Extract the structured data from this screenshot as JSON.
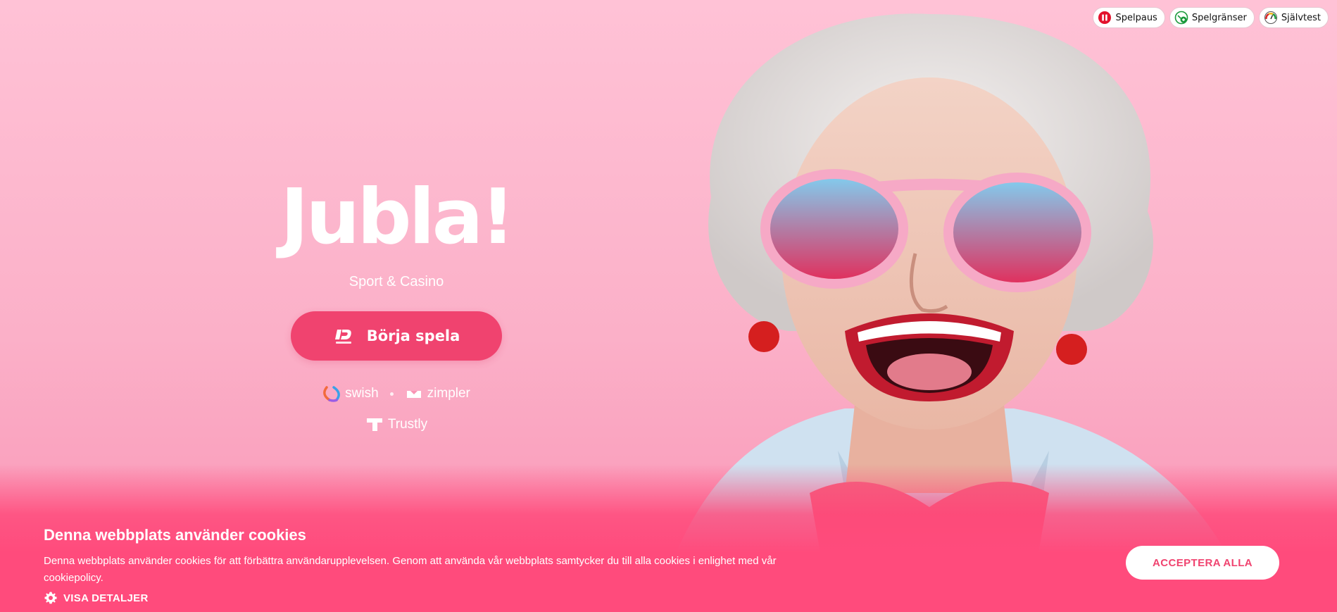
{
  "responsible_gaming": {
    "spelpaus_label": "Spelpaus",
    "spelgranser_label": "Spelgränser",
    "sjalvtest_label": "Självtest"
  },
  "brand": {
    "logo_text": "Jubla!",
    "tagline": "Sport & Casino"
  },
  "cta": {
    "label": "Börja spela",
    "icon": "bankid-icon"
  },
  "payments": {
    "swish_label": "swish",
    "zimpler_label": "zimpler",
    "trustly_label": "Trustly"
  },
  "cookie_banner": {
    "title": "Denna webbplats använder cookies",
    "text": "Denna webbplats använder cookies för att förbättra användarupplevelsen. Genom att använda vår webbplats samtycker du till alla cookies i enlighet med vår cookiepolicy.",
    "details_label": "VISA DETALJER",
    "accept_label": "ACCEPTERA ALLA"
  },
  "colors": {
    "accent": "#f0436f",
    "background": "#ffc2d6",
    "banner": "#ff4b7c"
  }
}
